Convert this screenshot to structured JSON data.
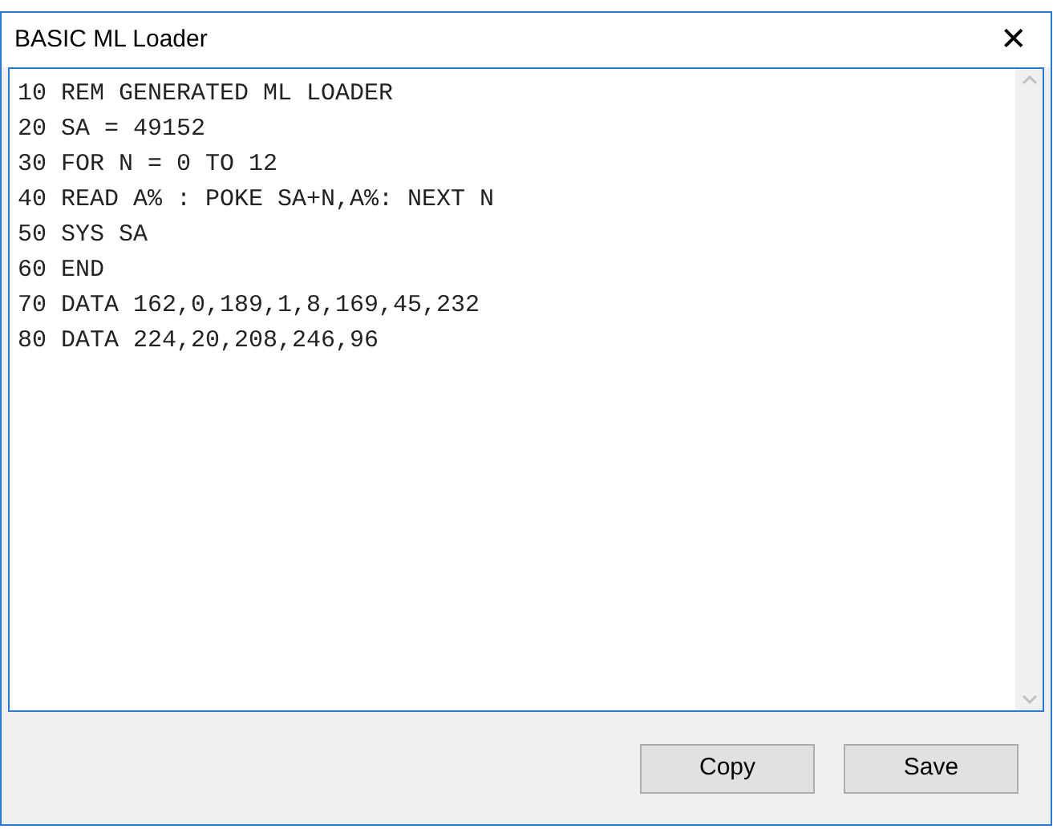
{
  "window": {
    "title": "BASIC ML Loader",
    "close": "✕"
  },
  "editor": {
    "lines": [
      "10 REM GENERATED ML LOADER",
      "20 SA = 49152",
      "30 FOR N = 0 TO 12",
      "40 READ A% : POKE SA+N,A%: NEXT N",
      "50 SYS SA",
      "60 END",
      "70 DATA 162,0,189,1,8,169,45,232",
      "80 DATA 224,20,208,246,96"
    ]
  },
  "buttons": [
    "Copy",
    "Save"
  ]
}
